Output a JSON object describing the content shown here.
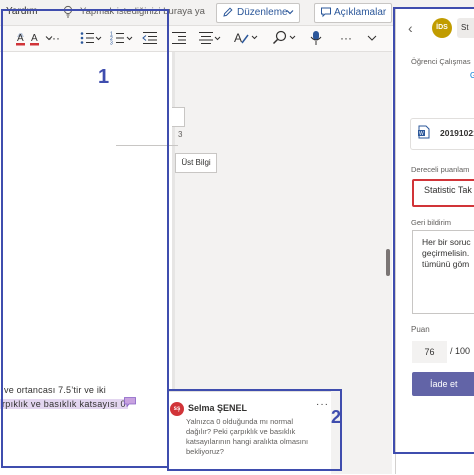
{
  "menu": {
    "help": "Yardım",
    "search_hint": "Yapmak istediğinizi buraya ya",
    "edit_mode": "Düzenleme",
    "comments": "Açıklamalar"
  },
  "ribbon": {
    "font_color_icon": "font-color-icon",
    "more": "···"
  },
  "document": {
    "ruler_number": "3",
    "header_button": "Üst Bilgi",
    "line1": "ve ortancası 7.5’tir ve iki",
    "line2": "rpıklık ve basıklık katsayısı 0"
  },
  "comment": {
    "author_initials": "sş",
    "author": "Selma ŞENEL",
    "more": "···",
    "body": "Yalnızca 0 olduğunda mı normal dağılır? Peki çarpıklık ve basıklık katsayılarının hangi aralıkta olmasını bekliyoruz?"
  },
  "panel": {
    "student_initials": "İDS",
    "student_name": "St",
    "work_label": "Öğrenci Çalışmas",
    "work_link": "G",
    "file_name": "20191021",
    "rubric_label": "Dereceli puanlam",
    "rubric_name": "Statistic Tak",
    "feedback_label": "Geri bildirim",
    "feedback_text": "Her bir soruc\ngeçirmelisin.\ntümünü göm",
    "points_label": "Puan",
    "points_value": "76",
    "points_max": "/ 100",
    "return_label": "İade et"
  },
  "annotations": {
    "box1": "1",
    "box2": "2"
  },
  "colors": {
    "accent": "#3f4dae",
    "teams_purple": "#6264a7",
    "highlight": "#e3d6f0",
    "rubric_border": "#d13438",
    "word_blue": "#2b579a"
  }
}
